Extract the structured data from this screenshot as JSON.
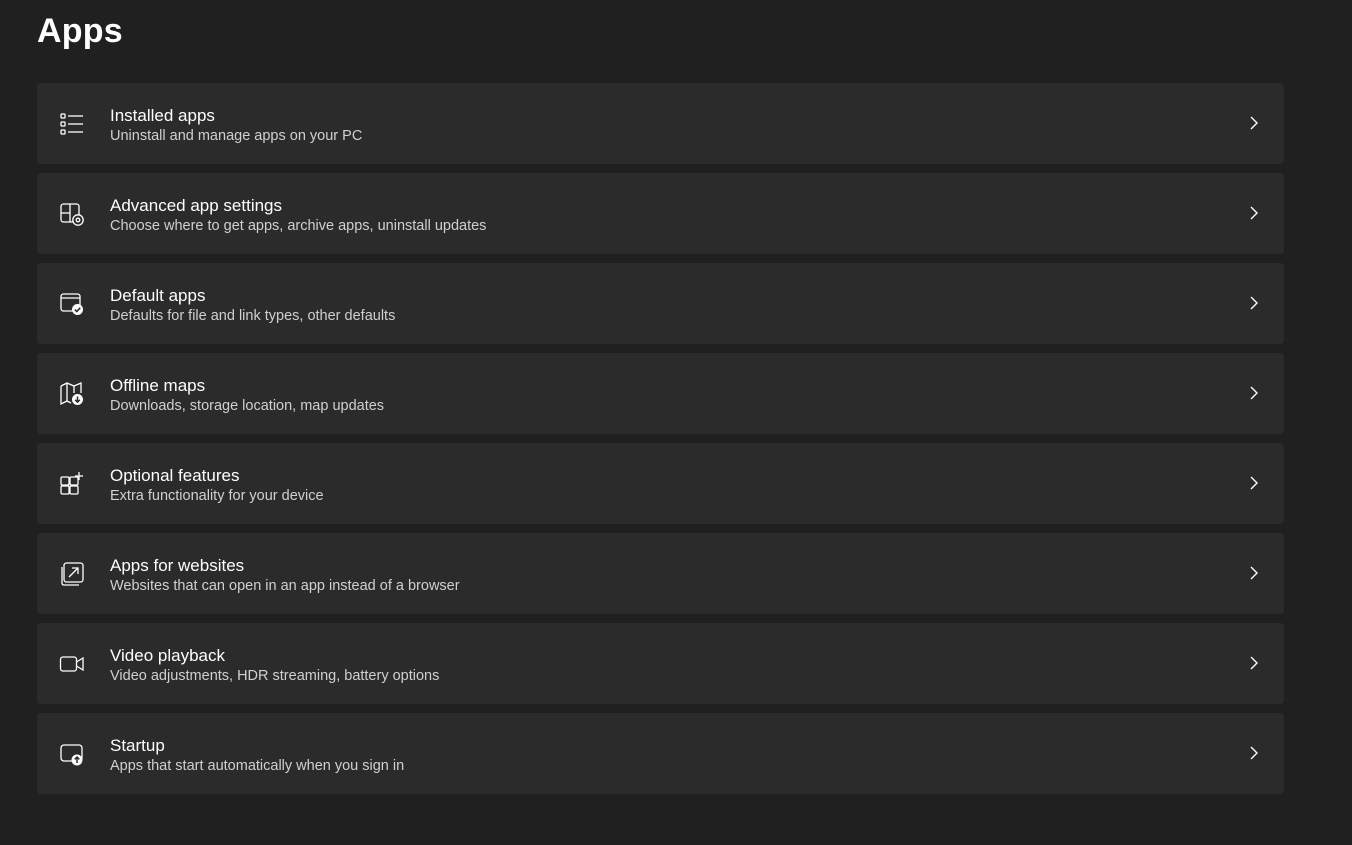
{
  "page": {
    "title": "Apps"
  },
  "items": [
    {
      "icon": "installed-apps-list-icon",
      "title": "Installed apps",
      "subtitle": "Uninstall and manage apps on your PC"
    },
    {
      "icon": "app-settings-gear-icon",
      "title": "Advanced app settings",
      "subtitle": "Choose where to get apps, archive apps, uninstall updates"
    },
    {
      "icon": "default-apps-check-icon",
      "title": "Default apps",
      "subtitle": "Defaults for file and link types, other defaults"
    },
    {
      "icon": "map-download-icon",
      "title": "Offline maps",
      "subtitle": "Downloads, storage location, map updates"
    },
    {
      "icon": "grid-add-icon",
      "title": "Optional features",
      "subtitle": "Extra functionality for your device"
    },
    {
      "icon": "open-external-icon",
      "title": "Apps for websites",
      "subtitle": "Websites that can open in an app instead of a browser"
    },
    {
      "icon": "video-camera-icon",
      "title": "Video playback",
      "subtitle": "Video adjustments, HDR streaming, battery options"
    },
    {
      "icon": "startup-arrow-icon",
      "title": "Startup",
      "subtitle": "Apps that start automatically when you sign in"
    }
  ],
  "colors": {
    "background": "#202020",
    "card": "#2b2b2b",
    "title_text": "#ffffff",
    "subtitle_text": "#d0d0d0"
  }
}
